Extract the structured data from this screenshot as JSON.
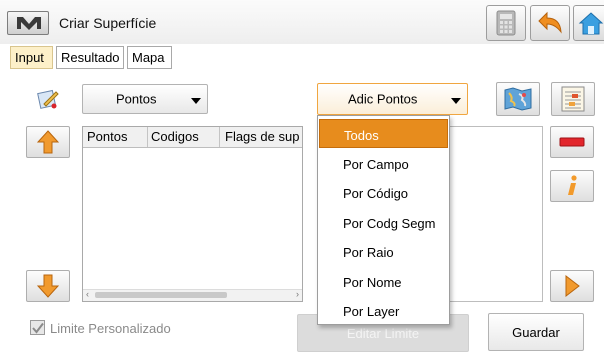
{
  "window": {
    "title": "Criar Superfície"
  },
  "tabs": [
    {
      "label": "Input",
      "active": true
    },
    {
      "label": "Resultado",
      "active": false
    },
    {
      "label": "Mapa",
      "active": false
    }
  ],
  "toolbar": {
    "points_dropdown": "Pontos",
    "add_points_dropdown": "Adic Pontos"
  },
  "table": {
    "columns": [
      "Pontos",
      "Codigos",
      "Flags de sup"
    ],
    "rows": []
  },
  "menu": {
    "items": [
      "Todos",
      "Por Campo",
      "Por Código",
      "Por Codg Segm",
      "Por Raio",
      "Por Nome",
      "Por Layer"
    ],
    "selected": "Todos"
  },
  "footer": {
    "checkbox_label": "Limite Personalizado",
    "checkbox_checked": true,
    "edit_limit_label": "Editar Limite",
    "save_label": "Guardar"
  },
  "colors": {
    "menu_highlight": "#e78c1d",
    "active_tab": "#fdf0c9",
    "dropdown_focus_border": "#f0a640"
  },
  "icons": [
    "m-logo-icon",
    "calculator-icon",
    "back-arrow-icon",
    "home-icon",
    "edit-point-icon",
    "map-icon",
    "layer-list-icon",
    "arrow-up-icon",
    "arrow-down-icon",
    "remove-icon",
    "info-icon",
    "arrow-right-icon",
    "checkmark-icon"
  ]
}
